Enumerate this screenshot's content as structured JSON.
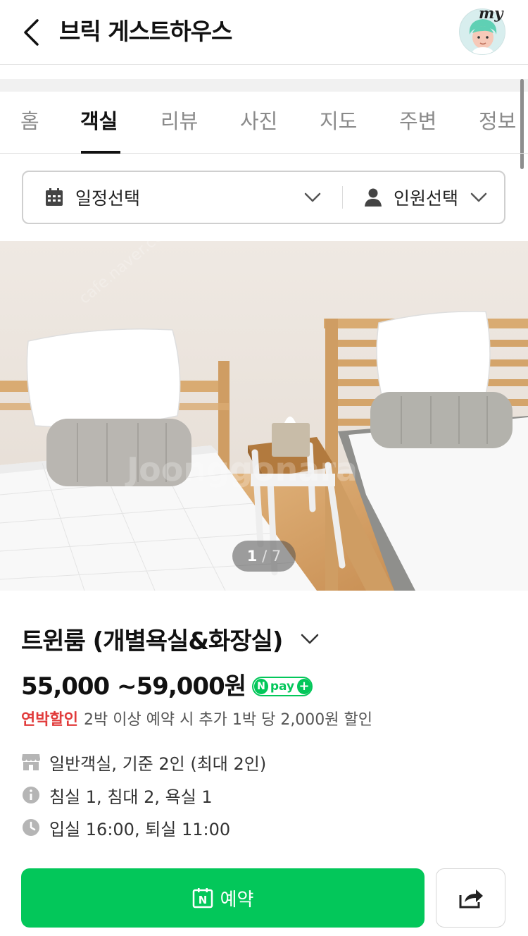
{
  "header": {
    "title": "브릭 게스트하우스",
    "avatar_text": "my"
  },
  "tabs": [
    {
      "label": "홈"
    },
    {
      "label": "객실"
    },
    {
      "label": "리뷰"
    },
    {
      "label": "사진"
    },
    {
      "label": "지도"
    },
    {
      "label": "주변"
    },
    {
      "label": "정보"
    }
  ],
  "active_tab": "객실",
  "selector": {
    "date_label": "일정선택",
    "people_label": "인원선택"
  },
  "photo": {
    "current": "1",
    "separator": " / ",
    "total": "7"
  },
  "room": {
    "name": "트윈룸 (개별욕실&화장실)",
    "price": "55,000 ~59,000원",
    "npay_n": "N",
    "npay_text": "pay",
    "npay_plus": "+",
    "discount_label": "연박할인",
    "discount_text": "2박 이상 예약 시 추가 1박 당 2,000원 할인",
    "info": [
      {
        "icon": "store-icon",
        "text": "일반객실, 기준 2인 (최대 2인)"
      },
      {
        "icon": "info-icon",
        "text": "침실 1, 침대 2, 욕실 1"
      },
      {
        "icon": "clock-icon",
        "text": "입실 16:00, 퇴실 11:00"
      }
    ]
  },
  "actions": {
    "reserve_label": "예약",
    "reserve_icon_letter": "N"
  },
  "colors": {
    "accent_green": "#03c75a",
    "discount_red": "#e13b3b"
  }
}
